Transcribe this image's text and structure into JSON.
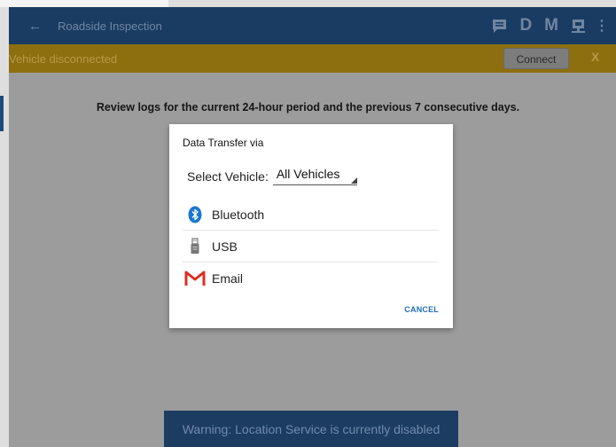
{
  "topbar": {
    "title": "Roadside Inspection",
    "actions": [
      {
        "name": "logs-icon"
      },
      {
        "label": "D"
      },
      {
        "label": "M"
      },
      {
        "name": "device-icon"
      },
      {
        "name": "overflow-menu-icon"
      }
    ]
  },
  "notice": {
    "text": "Vehicle disconnected",
    "connect_label": "Connect",
    "close_label": "X"
  },
  "main": {
    "review_text": "Review logs for the current 24-hour period and the previous 7 consecutive days."
  },
  "dialog": {
    "title": "Data Transfer via",
    "select_label": "Select Vehicle:",
    "select_value": "All Vehicles",
    "options": [
      {
        "label": "Bluetooth",
        "icon": "bluetooth-icon",
        "icon_color": "#1976d2"
      },
      {
        "label": "USB",
        "icon": "usb-icon",
        "icon_color": "#777777"
      },
      {
        "label": "Email",
        "icon": "gmail-icon",
        "icon_color": "#d93025"
      }
    ],
    "cancel_label": "CANCEL"
  },
  "warning": {
    "text": "Warning: Location Service is currently disabled"
  },
  "colors": {
    "topbar": "#1a3c63",
    "notice": "#8e6f10",
    "accent": "#1f6fb8"
  }
}
